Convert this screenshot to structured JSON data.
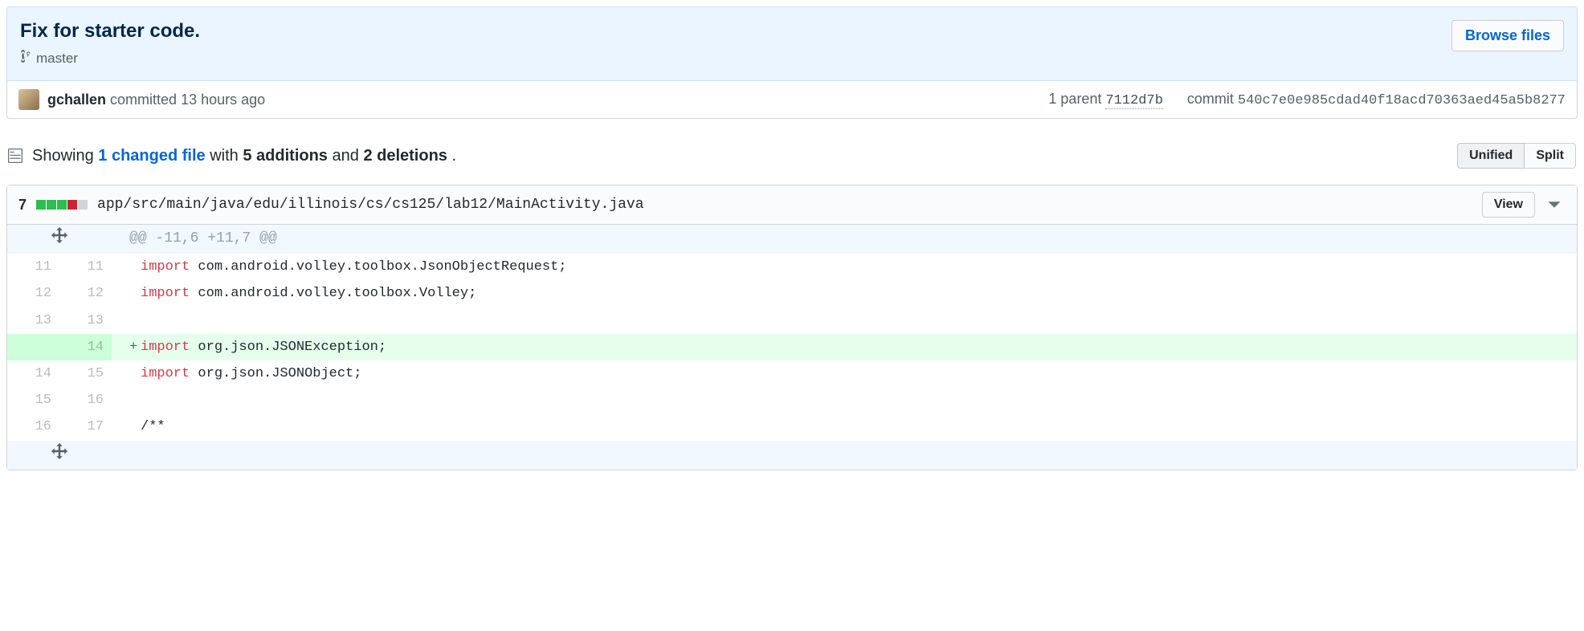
{
  "commit": {
    "title": "Fix for starter code.",
    "branch": "master",
    "browse_files_label": "Browse files",
    "author": "gchallen",
    "committed_phrase": "committed 13 hours ago",
    "parent_label": "1 parent",
    "parent_sha_short": "7112d7b",
    "commit_label": "commit",
    "commit_sha": "540c7e0e985cdad40f18acd70363aed45a5b8277"
  },
  "toc": {
    "showing_prefix": "Showing",
    "changed_files_link": "1 changed file",
    "with_text": "with",
    "additions_bold": "5 additions",
    "and_text": "and",
    "deletions_bold": "2 deletions",
    "period": ".",
    "unified_label": "Unified",
    "split_label": "Split"
  },
  "file": {
    "change_count": "7",
    "path": "app/src/main/java/edu/illinois/cs/cs125/lab12/MainActivity.java",
    "view_label": "View",
    "squares": [
      "add",
      "add",
      "add",
      "del",
      "neutral"
    ],
    "hunk_header": "@@ -11,6 +11,7 @@",
    "lines": [
      {
        "type": "context",
        "old": "11",
        "new": "11",
        "kw": "import",
        "rest": " com.android.volley.toolbox.JsonObjectRequest;"
      },
      {
        "type": "context",
        "old": "12",
        "new": "12",
        "kw": "import",
        "rest": " com.android.volley.toolbox.Volley;"
      },
      {
        "type": "context",
        "old": "13",
        "new": "13",
        "kw": "",
        "rest": ""
      },
      {
        "type": "add",
        "old": "",
        "new": "14",
        "kw": "import",
        "rest": " org.json.JSONException;"
      },
      {
        "type": "context",
        "old": "14",
        "new": "15",
        "kw": "import",
        "rest": " org.json.JSONObject;"
      },
      {
        "type": "context",
        "old": "15",
        "new": "16",
        "kw": "",
        "rest": ""
      },
      {
        "type": "context",
        "old": "16",
        "new": "17",
        "kw": "",
        "rest": "/**"
      }
    ]
  }
}
